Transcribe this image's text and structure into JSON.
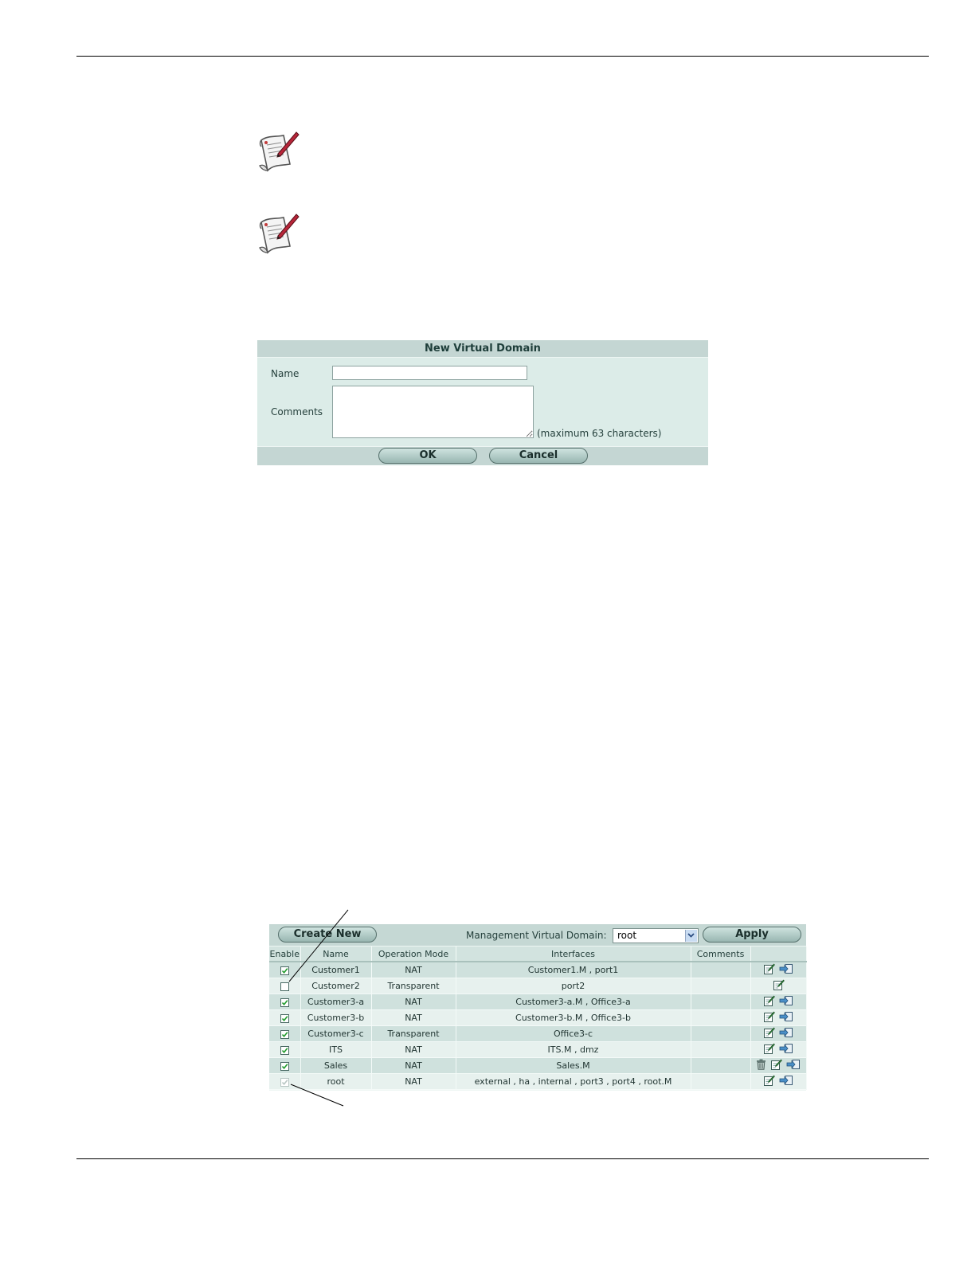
{
  "dialog": {
    "title": "New Virtual Domain",
    "name_label": "Name",
    "name_value": "",
    "comments_label": "Comments",
    "comments_value": "",
    "comments_hint": "(maximum 63 characters)",
    "ok_label": "OK",
    "cancel_label": "Cancel"
  },
  "vdom_list": {
    "create_new_label": "Create New",
    "management_label": "Management Virtual Domain:",
    "management_value": "root",
    "apply_label": "Apply",
    "columns": [
      "Enable",
      "Name",
      "Operation Mode",
      "Interfaces",
      "Comments"
    ],
    "rows": [
      {
        "enabled": true,
        "disabled_checkbox": false,
        "name": "Customer1",
        "mode": "NAT",
        "interfaces": "Customer1.M , port1",
        "comments": "",
        "delete": false,
        "edit": true,
        "enter": true
      },
      {
        "enabled": false,
        "disabled_checkbox": false,
        "name": "Customer2",
        "mode": "Transparent",
        "interfaces": "port2",
        "comments": "",
        "delete": false,
        "edit": true,
        "enter": false
      },
      {
        "enabled": true,
        "disabled_checkbox": false,
        "name": "Customer3-a",
        "mode": "NAT",
        "interfaces": "Customer3-a.M , Office3-a",
        "comments": "",
        "delete": false,
        "edit": true,
        "enter": true
      },
      {
        "enabled": true,
        "disabled_checkbox": false,
        "name": "Customer3-b",
        "mode": "NAT",
        "interfaces": "Customer3-b.M , Office3-b",
        "comments": "",
        "delete": false,
        "edit": true,
        "enter": true
      },
      {
        "enabled": true,
        "disabled_checkbox": false,
        "name": "Customer3-c",
        "mode": "Transparent",
        "interfaces": "Office3-c",
        "comments": "",
        "delete": false,
        "edit": true,
        "enter": true
      },
      {
        "enabled": true,
        "disabled_checkbox": false,
        "name": "ITS",
        "mode": "NAT",
        "interfaces": "ITS.M , dmz",
        "comments": "",
        "delete": false,
        "edit": true,
        "enter": true
      },
      {
        "enabled": true,
        "disabled_checkbox": false,
        "name": "Sales",
        "mode": "NAT",
        "interfaces": "Sales.M",
        "comments": "",
        "delete": true,
        "edit": true,
        "enter": true
      },
      {
        "enabled": true,
        "disabled_checkbox": true,
        "name": "root",
        "mode": "NAT",
        "interfaces": "external , ha , internal , port3 , port4 , root.M",
        "comments": "",
        "delete": false,
        "edit": true,
        "enter": true
      }
    ]
  },
  "icons": {
    "note": "note-pencil-icon",
    "edit": "edit-icon",
    "enter": "enter-vdom-icon",
    "delete": "trash-icon",
    "dropdown": "chevron-down-icon"
  },
  "colors": {
    "panel_bg": "#dcece8",
    "panel_header": "#c4d6d3",
    "row_odd": "#cfe1dd",
    "row_even": "#e7f1ee",
    "check": "#1e9a2a"
  }
}
